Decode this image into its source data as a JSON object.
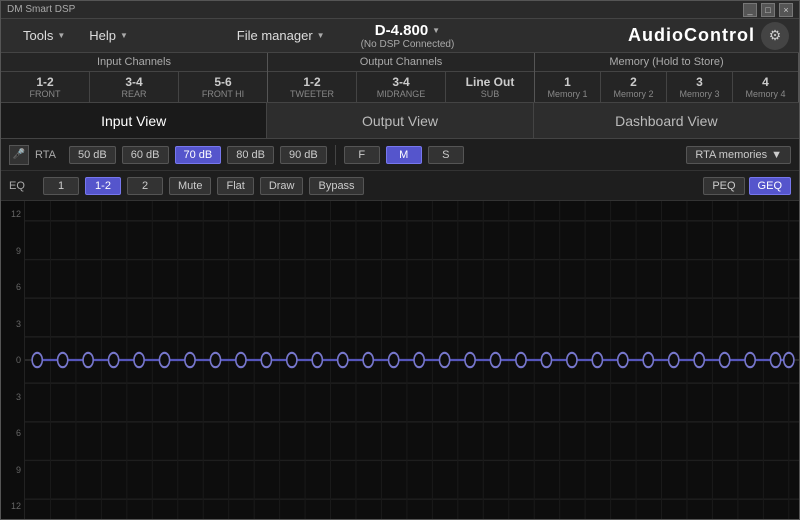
{
  "titleBar": {
    "title": "DM Smart DSP",
    "controls": [
      "_",
      "□",
      "×"
    ]
  },
  "menuBar": {
    "tools": "Tools",
    "toolsArrow": "▼",
    "help": "Help",
    "helpArrow": "▼",
    "fileManager": "File manager",
    "fileManagerArrow": "▼",
    "deviceName": "D-4.800",
    "deviceArrow": "▼",
    "deviceStatus": "(No DSP Connected)",
    "brandName": "AudioControl",
    "brandIcon": "⚙"
  },
  "channelHeaders": {
    "inputGroup": {
      "title": "Input Channels",
      "tabs": [
        {
          "num": "1-2",
          "label": "FRONT"
        },
        {
          "num": "3-4",
          "label": "REAR"
        },
        {
          "num": "5-6",
          "label": "FRONT HI"
        }
      ]
    },
    "outputGroup": {
      "title": "Output Channels",
      "tabs": [
        {
          "num": "1-2",
          "label": "TWEETER"
        },
        {
          "num": "3-4",
          "label": "MIDRANGE"
        },
        {
          "num": "Line Out",
          "label": "SUB"
        }
      ]
    },
    "memoryGroup": {
      "title": "Memory (Hold to Store)",
      "tabs": [
        {
          "num": "1",
          "label": "Memory 1"
        },
        {
          "num": "2",
          "label": "Memory 2"
        },
        {
          "num": "3",
          "label": "Memory 3"
        },
        {
          "num": "4",
          "label": "Memory 4"
        }
      ]
    }
  },
  "viewSelector": {
    "views": [
      "Input View",
      "Output View",
      "Dashboard View"
    ],
    "activeView": "Input View"
  },
  "rtaControls": {
    "label": "RTA",
    "dbOptions": [
      "50 dB",
      "60 dB",
      "70 dB",
      "80 dB",
      "90 dB"
    ],
    "activeDb": "70 dB",
    "modeOptions": [
      "F",
      "M",
      "S"
    ],
    "activeMode": "M",
    "dropdown": "RTA memories",
    "dropdownArrow": "▼"
  },
  "eqControls": {
    "label": "EQ",
    "channelOptions": [
      "1",
      "1-2",
      "2"
    ],
    "activeChannel": "1-2",
    "actions": [
      "Mute",
      "Flat",
      "Draw",
      "Bypass"
    ],
    "typeOptions": [
      "PEQ",
      "GEQ"
    ],
    "activeType": "GEQ"
  },
  "chart": {
    "yLabels": [
      "12",
      "9",
      "6",
      "3",
      "0",
      "3",
      "6",
      "9",
      "12"
    ],
    "pointCount": 31,
    "zeroLineRatio": 0.5
  }
}
